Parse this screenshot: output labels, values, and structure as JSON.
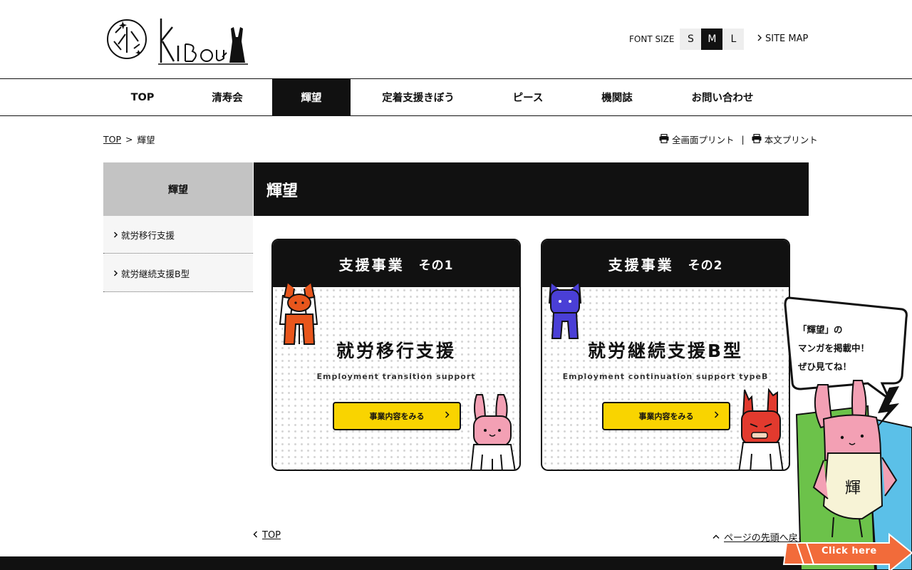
{
  "header": {
    "logo_text": "KIBou",
    "font_size_label": "FONT SIZE",
    "font_sizes": [
      "S",
      "M",
      "L"
    ],
    "font_size_active": "M",
    "site_map": "SITE MAP"
  },
  "nav": {
    "items": [
      "TOP",
      "清寿会",
      "輝望",
      "定着支援きぼう",
      "ピース",
      "機関誌",
      "お問い合わせ"
    ],
    "active": "輝望"
  },
  "breadcrumb": {
    "home": "TOP",
    "separator": ">",
    "current": "輝望"
  },
  "print": {
    "full": "全画面プリント",
    "separator": "|",
    "body": "本文プリント"
  },
  "sidebar": {
    "heading": "輝望",
    "items": [
      "就労移行支援",
      "就労継続支援B型"
    ]
  },
  "main": {
    "title": "輝望"
  },
  "cards": [
    {
      "head": "支援事業",
      "head_sub": "その1",
      "title": "就労移行支援",
      "subtitle": "Employment transition support",
      "button": "事業内容をみる"
    },
    {
      "head": "支援事業",
      "head_sub": "その2",
      "title": "就労継続支援B型",
      "subtitle": "Employment continuation support typeB",
      "button": "事業内容をみる"
    }
  ],
  "footer_links": {
    "top": "TOP",
    "page_top": "ページの先頭へ戻る"
  },
  "manga": {
    "lines": [
      "「輝望」の",
      "マンガを掲載中！",
      "ぜひ見てね！"
    ],
    "button": "Click here",
    "shirt_text": "輝"
  },
  "colors": {
    "black": "#111111",
    "nav_active_bg": "#111111",
    "sidebar_head_bg": "#c3c3c3",
    "button_yellow": "#f9d400",
    "click_orange": "#f26b3a",
    "char_orange": "#e8561c",
    "char_blue": "#4a3fd6",
    "char_red": "#e23a2e",
    "char_pink": "#f3a0b4"
  }
}
